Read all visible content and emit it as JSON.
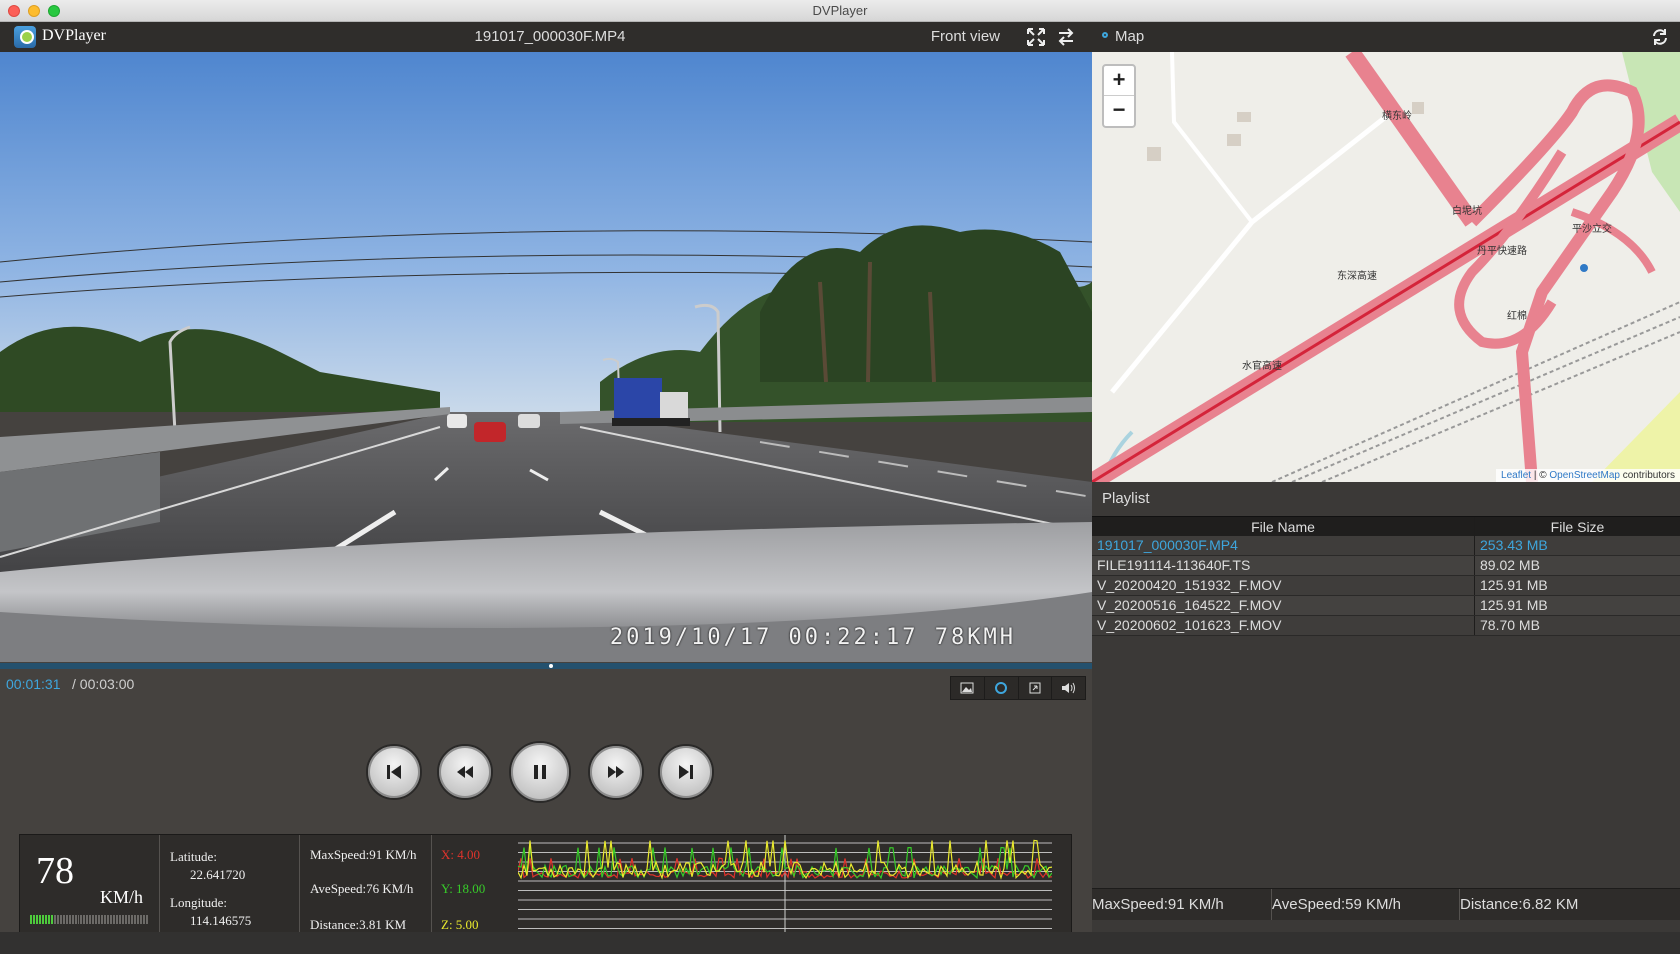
{
  "window": {
    "title": "DVPlayer"
  },
  "player": {
    "app_name": "DVPlayer",
    "file_title": "191017_000030F.MP4",
    "view_label": "Front view",
    "osd_text": "2019/10/17  00:22:17  78KMH",
    "current_time": "00:01:31",
    "total_time": "/ 00:03:00",
    "progress": 0.505
  },
  "controls": {
    "prev": "skip-previous-icon",
    "rewind": "rewind-icon",
    "pause": "pause-icon",
    "forward": "fast-forward-icon",
    "next": "skip-next-icon"
  },
  "telemetry": {
    "speed": "78",
    "speed_unit": "KM/h",
    "speed_level": 0.2,
    "latitude_label": "Latitude:",
    "latitude": "22.641720",
    "longitude_label": "Longitude:",
    "longitude": "114.146575",
    "max_speed": "MaxSpeed:91 KM/h",
    "ave_speed": "AveSpeed:76 KM/h",
    "distance": "Distance:3.81 KM",
    "x": "X: 4.00",
    "y": "Y: 18.00",
    "z": "Z: 5.00"
  },
  "map": {
    "title": "Map",
    "zoom_in": "+",
    "zoom_out": "−",
    "attribution_leaflet": "Leaflet",
    "attribution_sep": " | © ",
    "attribution_osm": "OpenStreetMap",
    "attribution_tail": " contributors",
    "labels": [
      "东深高速",
      "平沙立交",
      "丹平快速路",
      "水官高速",
      "横东岭",
      "白坭坑",
      "红棉"
    ]
  },
  "playlist": {
    "title": "Playlist",
    "col_name": "File Name",
    "col_size": "File Size",
    "rows": [
      {
        "name": "191017_000030F.MP4",
        "size": "253.43 MB"
      },
      {
        "name": "FILE191114-113640F.TS",
        "size": "89.02 MB"
      },
      {
        "name": "V_20200420_151932_F.MOV",
        "size": "125.91 MB"
      },
      {
        "name": "V_20200516_164522_F.MOV",
        "size": "125.91 MB"
      },
      {
        "name": "V_20200602_101623_F.MOV",
        "size": "78.70 MB"
      }
    ]
  },
  "summary": {
    "max_speed": "MaxSpeed:91 KM/h",
    "ave_speed": "AveSpeed:59 KM/h",
    "distance": "Distance:6.82 KM"
  },
  "colors": {
    "accent": "#3ea6dd",
    "x": "#e0332c",
    "y": "#37cc29",
    "z": "#eaea2d"
  }
}
